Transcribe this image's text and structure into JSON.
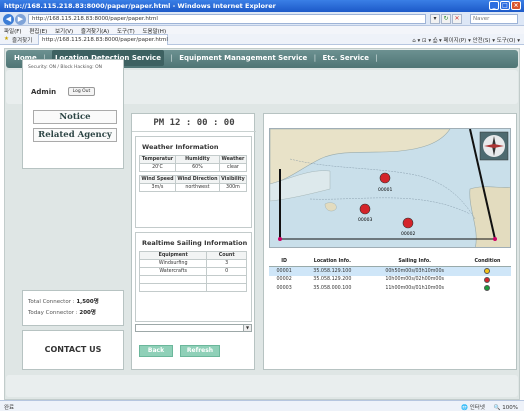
{
  "window": {
    "title": "http://168.115.218.83:8000/paper/paper.html - Windows Internet Explorer",
    "buttons": [
      "_",
      "□",
      "×"
    ]
  },
  "toolbar": {
    "back_icon": "back-arrow-icon",
    "forward_icon": "forward-arrow-icon",
    "address": "http://168.115.218.83:8000/paper/paper.html",
    "search_placeholder": "Naver"
  },
  "menu": {
    "items": [
      "파일(F)",
      "편집(E)",
      "보기(V)",
      "즐겨찾기(A)",
      "도구(T)",
      "도움말(H)"
    ]
  },
  "favorites": {
    "label": "즐겨찾기",
    "tab_title": "http://168.115.218.83:8000/paper/paper.html",
    "commands": "페이지(P) ▾  안전(S) ▾  도구(O) ▾"
  },
  "nav": {
    "items": [
      "Home",
      "Location Detection Service",
      "Equipment Management Service",
      "Etc. Service"
    ],
    "active_index": 1
  },
  "left": {
    "security_text": "Security: ON / Block Hacking: ON",
    "admin_label": "Admin",
    "logout_label": "Log Out",
    "notice_label": "Notice",
    "agency_label": "Related Agency",
    "total_label": "Total Connector :",
    "total_value": "1,500명",
    "today_label": "Today Connector :",
    "today_value": "200명",
    "contact_label": "CONTACT US"
  },
  "clock": {
    "text": "PM   12 : 00 : 00"
  },
  "weather": {
    "title": "Weather Information",
    "row1_headers": [
      "Temperatur",
      "Humidity",
      "Weather"
    ],
    "row1_values": [
      "20'C",
      "60%",
      "clear"
    ],
    "row2_headers": [
      "Wind Speed",
      "Wind Direction",
      "Visibility"
    ],
    "row2_values": [
      "3m/s",
      "northwest",
      "300m"
    ]
  },
  "sailing": {
    "title": "Realtime Sailing Information",
    "headers": [
      "Equipment",
      "Count"
    ],
    "rows": [
      {
        "equipment": "Windsurfing",
        "count": "3"
      },
      {
        "equipment": "Watercrafts",
        "count": "0"
      }
    ]
  },
  "buttons": {
    "back": "Back",
    "refresh": "Refresh"
  },
  "map": {
    "markers": [
      "00001",
      "00002",
      "00003"
    ]
  },
  "table": {
    "headers": [
      "ID",
      "Location Info.",
      "Sailing Info.",
      "Condition"
    ],
    "rows": [
      {
        "id": "00001",
        "location": "35.058.129.100",
        "sailing": "00h50m00s/03h10m00s",
        "color": "#f2c21b"
      },
      {
        "id": "00002",
        "location": "35.058.129.200",
        "sailing": "10h00m00s/02h00m00s",
        "color": "#d4242a"
      },
      {
        "id": "00003",
        "location": "35.058.000.100",
        "sailing": "11h00m00s/01h10m00s",
        "color": "#1c9b3b"
      }
    ],
    "selected_index": 0
  },
  "status": {
    "left": "완료",
    "zone": "인터넷",
    "zoom": "100%"
  }
}
